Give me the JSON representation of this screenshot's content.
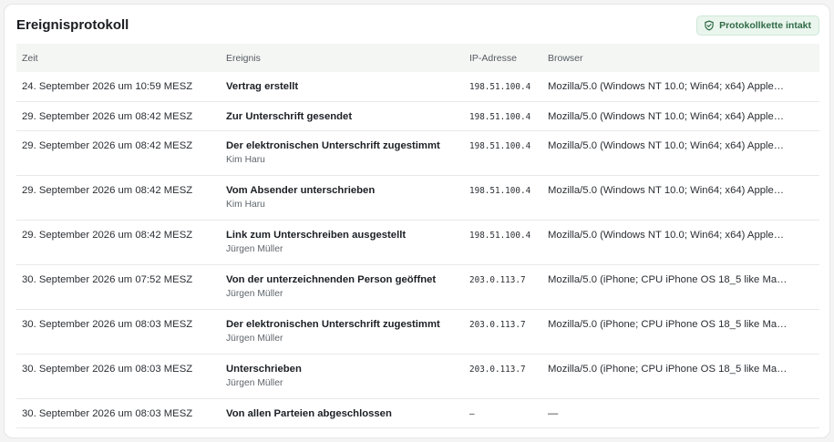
{
  "card": {
    "title": "Ereignisprotokoll",
    "badge": {
      "label": "Protokollkette intakt",
      "icon": "shield-check-icon",
      "color": "#2f6b45"
    }
  },
  "table": {
    "headers": [
      "Zeit",
      "Ereignis",
      "IP-Adresse",
      "Browser"
    ],
    "rows": [
      {
        "time": "24. September 2026 um 10:59 MESZ",
        "event": "Vertrag erstellt",
        "actor": "",
        "ip": "198.51.100.4",
        "browser": "Mozilla/5.0 (Windows NT 10.0; Win64; x64) Apple…"
      },
      {
        "time": "29. September 2026 um 08:42 MESZ",
        "event": "Zur Unterschrift gesendet",
        "actor": "",
        "ip": "198.51.100.4",
        "browser": "Mozilla/5.0 (Windows NT 10.0; Win64; x64) Apple…"
      },
      {
        "time": "29. September 2026 um 08:42 MESZ",
        "event": "Der elektronischen Unterschrift zugestimmt",
        "actor": "Kim Haru",
        "ip": "198.51.100.4",
        "browser": "Mozilla/5.0 (Windows NT 10.0; Win64; x64) Apple…"
      },
      {
        "time": "29. September 2026 um 08:42 MESZ",
        "event": "Vom Absender unterschrieben",
        "actor": "Kim Haru",
        "ip": "198.51.100.4",
        "browser": "Mozilla/5.0 (Windows NT 10.0; Win64; x64) Apple…"
      },
      {
        "time": "29. September 2026 um 08:42 MESZ",
        "event": "Link zum Unterschreiben ausgestellt",
        "actor": "Jürgen Müller",
        "ip": "198.51.100.4",
        "browser": "Mozilla/5.0 (Windows NT 10.0; Win64; x64) Apple…"
      },
      {
        "time": "30. September 2026 um 07:52 MESZ",
        "event": "Von der unterzeichnenden Person geöffnet",
        "actor": "Jürgen Müller",
        "ip": "203.0.113.7",
        "browser": "Mozilla/5.0 (iPhone; CPU iPhone OS 18_5 like Ma…"
      },
      {
        "time": "30. September 2026 um 08:03 MESZ",
        "event": "Der elektronischen Unterschrift zugestimmt",
        "actor": "Jürgen Müller",
        "ip": "203.0.113.7",
        "browser": "Mozilla/5.0 (iPhone; CPU iPhone OS 18_5 like Ma…"
      },
      {
        "time": "30. September 2026 um 08:03 MESZ",
        "event": "Unterschrieben",
        "actor": "Jürgen Müller",
        "ip": "203.0.113.7",
        "browser": "Mozilla/5.0 (iPhone; CPU iPhone OS 18_5 like Ma…"
      },
      {
        "time": "30. September 2026 um 08:03 MESZ",
        "event": "Von allen Parteien abgeschlossen",
        "actor": "",
        "ip": "–",
        "browser": "—"
      }
    ]
  }
}
